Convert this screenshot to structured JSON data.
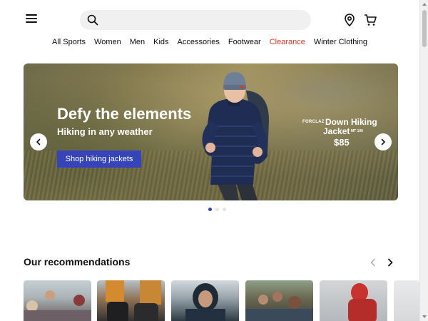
{
  "header": {
    "menu_icon": "hamburger-menu-icon",
    "search": {
      "placeholder": "",
      "value": "",
      "icon": "search-icon"
    },
    "store_locator_icon": "location-pin-icon",
    "cart_icon": "shopping-cart-icon"
  },
  "nav": {
    "items": [
      {
        "label": "All Sports"
      },
      {
        "label": "Women"
      },
      {
        "label": "Men"
      },
      {
        "label": "Kids"
      },
      {
        "label": "Accessories"
      },
      {
        "label": "Footwear"
      },
      {
        "label": "Clearance",
        "color": "#e0362b"
      },
      {
        "label": "Winter Clothing"
      }
    ]
  },
  "hero": {
    "title": "Defy the elements",
    "subtitle": "Hiking in any weather",
    "cta_label": "Shop hiking jackets",
    "cta_color": "#3643ba",
    "product": {
      "brand": "FORCLAZ",
      "name_line1": "Down Hiking",
      "name_line2": "Jacket",
      "model": "MT 100",
      "price": "$85"
    },
    "prev_icon": "chevron-left-icon",
    "next_icon": "chevron-right-icon",
    "carousel": {
      "slide_count": 3,
      "active_index": 0
    }
  },
  "recommendations": {
    "title": "Our recommendations",
    "prev_icon": "chevron-left-icon",
    "next_icon": "chevron-right-icon",
    "cards": [
      {
        "name": "family-snow-card"
      },
      {
        "name": "boots-card"
      },
      {
        "name": "hooded-man-card"
      },
      {
        "name": "group-hikers-card"
      },
      {
        "name": "red-jacket-card"
      },
      {
        "name": "partial-card"
      }
    ]
  },
  "colors": {
    "accent": "#3643ba",
    "clearance": "#e0362b",
    "text": "#101010"
  }
}
